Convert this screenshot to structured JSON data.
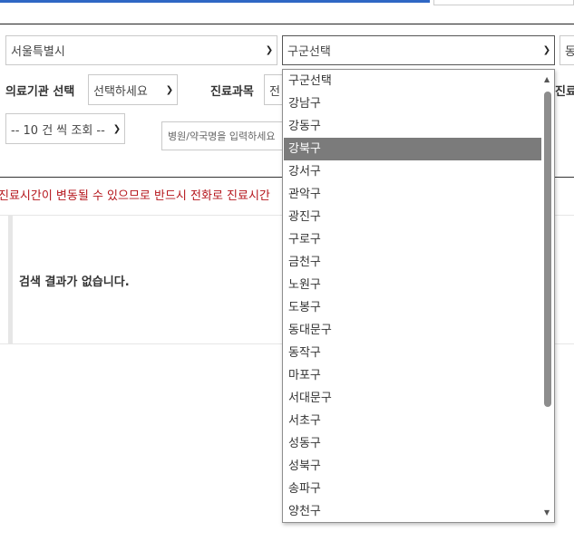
{
  "region": {
    "city_select": "서울특별시",
    "district_select": "구군선택",
    "dong_select_partial": "동"
  },
  "filters": {
    "institution_label": "의료기관 선택",
    "institution_value": "선택하세요",
    "department_label": "진료과목",
    "department_value_partial": "전",
    "department_label_right_partial": "진료",
    "page_size_select": "-- 10 건 씩 조회 --",
    "search_placeholder": "병원/약국명을 입력하세요"
  },
  "notice": "진료시간이 변동될 수 있으므로 반드시 전화로 진료시간",
  "results": {
    "empty_message": "검색 결과가 없습니다."
  },
  "district_dropdown": {
    "selected_index": 3,
    "options": [
      "구군선택",
      "강남구",
      "강동구",
      "강북구",
      "강서구",
      "관악구",
      "광진구",
      "구로구",
      "금천구",
      "노원구",
      "도봉구",
      "동대문구",
      "동작구",
      "마포구",
      "서대문구",
      "서초구",
      "성동구",
      "성북구",
      "송파구",
      "양천구"
    ]
  },
  "icons": {
    "select_arrow": "chevron-down-icon",
    "scroll_up": "triangle-up-icon",
    "scroll_down": "triangle-down-icon"
  },
  "colors": {
    "accent_blue": "#2f67c4",
    "notice_red": "#b5161c",
    "selected_option_bg": "#7b7b7b"
  }
}
